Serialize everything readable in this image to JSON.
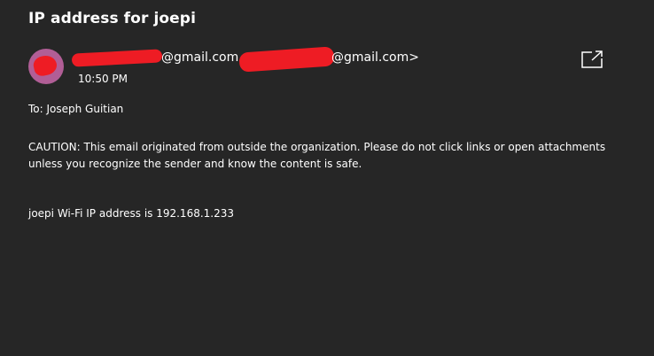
{
  "email": {
    "subject": "IP address for joepi",
    "from_line": {
      "part1": "@gmail.com",
      "part2": "@gmail.com>"
    },
    "time": "10:50 PM",
    "to": "To: Joseph Guitian",
    "caution": "CAUTION: This email originated from outside the organization. Please do not click links or open attachments unless you recognize the sender and know the content is safe.",
    "body": "joepi Wi-Fi IP address is 192.168.1.233"
  },
  "icons": {
    "popout": "open-in-new-window-icon",
    "avatar": "sender-avatar"
  },
  "colors": {
    "background": "#262626",
    "text": "#ffffff",
    "avatar": "#b15e96",
    "redaction": "#ee1c24"
  }
}
